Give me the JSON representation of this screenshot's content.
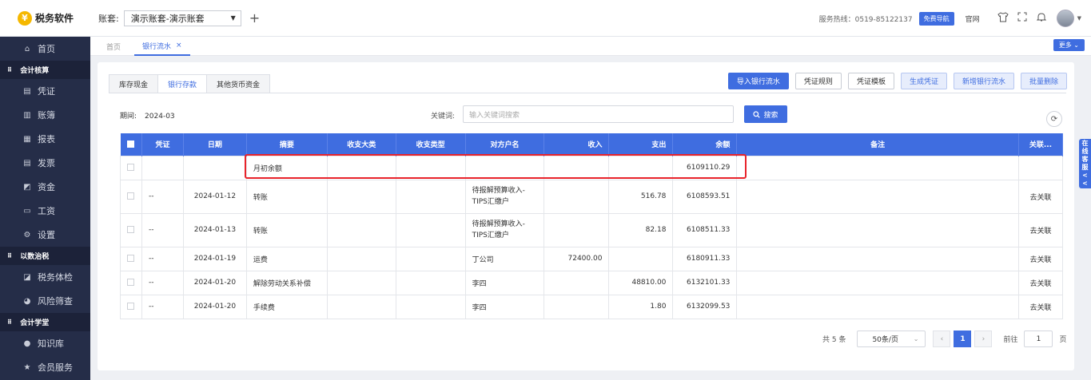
{
  "app": {
    "logo_text": "税务软件",
    "logo_glyph": "¥"
  },
  "header": {
    "account_label": "账套:",
    "account_value": "演示账套-演示账套",
    "hotline": "服务热线：0519-85122137",
    "guide_button": "免费导航",
    "website": "官网"
  },
  "sidebar": {
    "items": [
      {
        "label": "首页"
      },
      {
        "group": "会计核算"
      },
      {
        "label": "凭证"
      },
      {
        "label": "账簿"
      },
      {
        "label": "报表"
      },
      {
        "label": "发票"
      },
      {
        "label": "资金"
      },
      {
        "label": "工资"
      },
      {
        "label": "设置"
      },
      {
        "group": "以数治税"
      },
      {
        "label": "税务体检"
      },
      {
        "label": "风险筛查"
      },
      {
        "group": "会计学堂"
      },
      {
        "label": "知识库"
      },
      {
        "label": "会员服务"
      }
    ]
  },
  "tabs": {
    "home": "首页",
    "active": "银行流水",
    "more": "更多"
  },
  "subtabs": [
    "库存现金",
    "银行存款",
    "其他货币资金"
  ],
  "actions": [
    "导入银行流水",
    "凭证规则",
    "凭证模板",
    "生成凭证",
    "新增银行流水",
    "批量删除"
  ],
  "filter": {
    "period_label": "期间:",
    "period_value": "2024-03",
    "keyword_label": "关键词:",
    "keyword_placeholder": "输入关键词搜索",
    "search_button": "搜索"
  },
  "table": {
    "columns": [
      "凭证",
      "日期",
      "摘要",
      "收支大类",
      "收支类型",
      "对方户名",
      "收入",
      "支出",
      "余额",
      "备注",
      "关联..."
    ],
    "opening": {
      "summary": "月初余额",
      "balance": "6109110.29"
    },
    "rows": [
      {
        "voucher": "--",
        "date": "2024-01-12",
        "summary": "转账",
        "category": "",
        "type": "",
        "counterparty": "待报解预算收入-TIPS汇缴户",
        "income": "",
        "expense": "516.78",
        "balance": "6108593.51",
        "note": "",
        "action": "去关联"
      },
      {
        "voucher": "--",
        "date": "2024-01-13",
        "summary": "转账",
        "category": "",
        "type": "",
        "counterparty": "待报解预算收入-TIPS汇缴户",
        "income": "",
        "expense": "82.18",
        "balance": "6108511.33",
        "note": "",
        "action": "去关联"
      },
      {
        "voucher": "--",
        "date": "2024-01-19",
        "summary": "运费",
        "category": "",
        "type": "",
        "counterparty": "丁公司",
        "income": "72400.00",
        "expense": "",
        "balance": "6180911.33",
        "note": "",
        "action": "去关联"
      },
      {
        "voucher": "--",
        "date": "2024-01-20",
        "summary": "解除劳动关系补偿",
        "category": "",
        "type": "",
        "counterparty": "李四",
        "income": "",
        "expense": "48810.00",
        "balance": "6132101.33",
        "note": "",
        "action": "去关联"
      },
      {
        "voucher": "--",
        "date": "2024-01-20",
        "summary": "手续费",
        "category": "",
        "type": "",
        "counterparty": "李四",
        "income": "",
        "expense": "1.80",
        "balance": "6132099.53",
        "note": "",
        "action": "去关联"
      }
    ]
  },
  "pagination": {
    "total": "共 5 条",
    "page_size": "50条/页",
    "current": "1",
    "goto_label": "前往",
    "goto_value": "1",
    "page_unit": "页"
  },
  "online_service": "在线客服<<",
  "colors": {
    "accent": "#3f6de0",
    "sidebar": "#252d48",
    "highlight": "#e8232b"
  }
}
